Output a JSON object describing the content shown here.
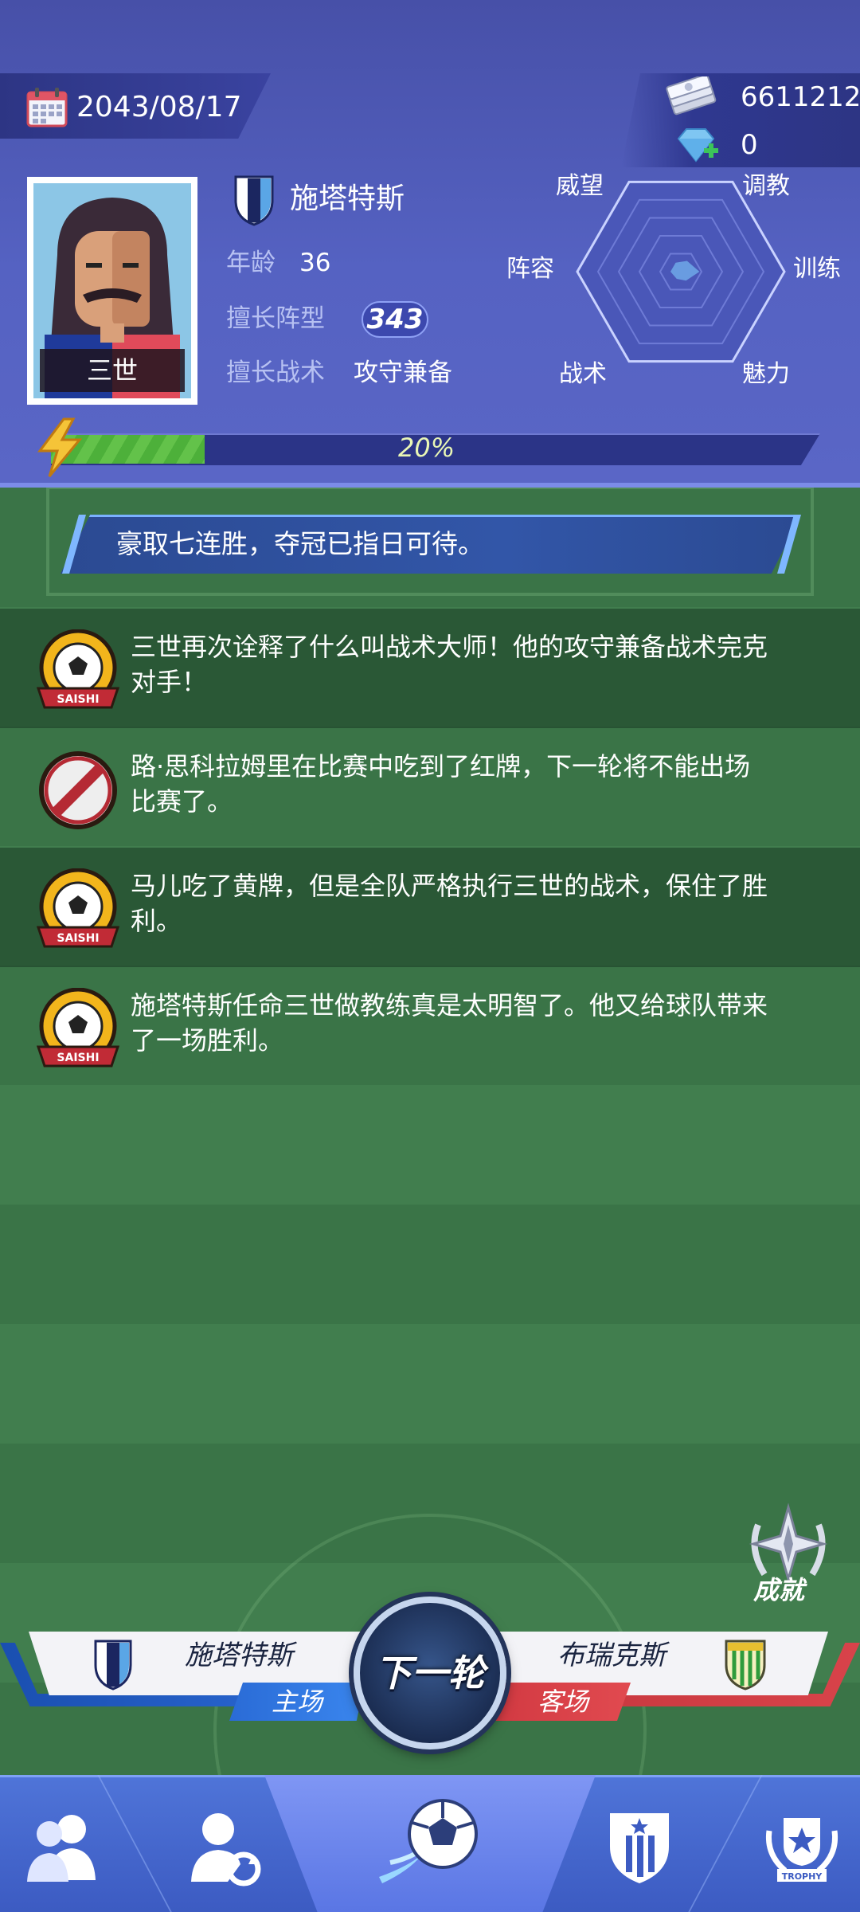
{
  "header": {
    "date": "2043/08/17",
    "cash": "6611212",
    "gems": "0"
  },
  "coach": {
    "name": "三世",
    "club": "施塔特斯",
    "age_label": "年龄",
    "age": "36",
    "formation_label": "擅长阵型",
    "formation": "343",
    "tactic_label": "擅长战术",
    "tactic": "攻守兼备"
  },
  "radar": {
    "labels": [
      "威望",
      "调教",
      "训练",
      "魅力",
      "战术",
      "阵容"
    ],
    "values": [
      0.1,
      0.12,
      0.18,
      0.1,
      0.08,
      0.1
    ]
  },
  "progress": {
    "value": 0.2,
    "label": "20%"
  },
  "banner": {
    "text": "豪取七连胜，夺冠已指日可待。"
  },
  "news": [
    {
      "icon": "saishi-ball-icon",
      "text": "三世再次诠释了什么叫战术大师！他的攻守兼备战术完克对手！"
    },
    {
      "icon": "red-card-ban-icon",
      "text": "路·思科拉姆里在比赛中吃到了红牌，下一轮将不能出场比赛了。"
    },
    {
      "icon": "saishi-ball-icon",
      "text": "马儿吃了黄牌，但是全队严格执行三世的战术，保住了胜利。"
    },
    {
      "icon": "saishi-ball-icon",
      "text": "施塔特斯任命三世做教练真是太明智了。他又给球队带来了一场胜利。"
    }
  ],
  "badge_text": "SAISHI",
  "achievement": {
    "label": "成就"
  },
  "match": {
    "home_team": "施塔特斯",
    "home_tag": "主场",
    "away_team": "布瑞克斯",
    "away_tag": "客场",
    "next_label": "下一轮"
  },
  "nav": {
    "items": [
      {
        "icon": "team-players-icon"
      },
      {
        "icon": "transfer-player-icon"
      },
      {
        "icon": "soccer-ball-icon"
      },
      {
        "icon": "club-shield-icon"
      },
      {
        "icon": "trophy-icon",
        "label": "TROPHY"
      }
    ]
  },
  "colors": {
    "header": "#5562c2",
    "field": "#3a7447",
    "progress": "#4db03a",
    "home": "#2d6cd8",
    "away": "#d8434a"
  }
}
